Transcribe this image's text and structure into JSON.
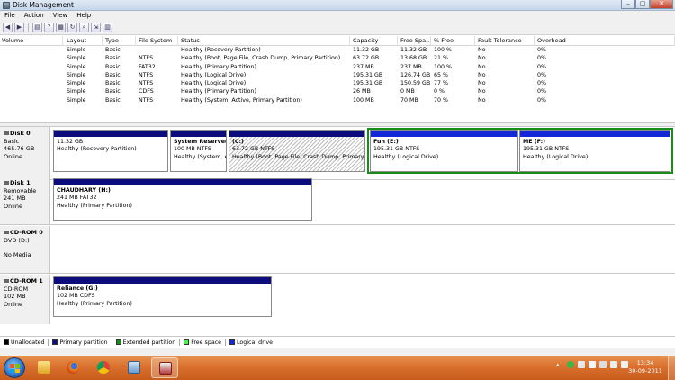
{
  "window": {
    "title": "Disk Management",
    "minimize": "–",
    "maximize": "□",
    "close": "✕"
  },
  "menu": [
    "File",
    "Action",
    "View",
    "Help"
  ],
  "toolbar": {
    "icons": [
      "back-icon",
      "forward-icon",
      "show-hide-tree-icon",
      "help-icon",
      "properties-icon",
      "refresh-icon",
      "rescan-icon",
      "export-icon",
      "view-icon"
    ]
  },
  "volume_list": {
    "columns": [
      "Volume",
      "Layout",
      "Type",
      "File System",
      "Status",
      "Capacity",
      "Free Spa...",
      "% Free",
      "Fault Tolerance",
      "Overhead"
    ],
    "rows": [
      {
        "volume": "",
        "layout": "Simple",
        "type": "Basic",
        "fs": "",
        "status": "Healthy (Recovery Partition)",
        "capacity": "11.32 GB",
        "free": "11.32 GB",
        "pct": "100 %",
        "fault": "No",
        "overhead": "0%"
      },
      {
        "volume": "(C:)",
        "layout": "Simple",
        "type": "Basic",
        "fs": "NTFS",
        "status": "Healthy (Boot, Page File, Crash Dump, Primary Partition)",
        "capacity": "63.72 GB",
        "free": "13.68 GB",
        "pct": "21 %",
        "fault": "No",
        "overhead": "0%"
      },
      {
        "volume": "CHAUDHARY (H:)",
        "layout": "Simple",
        "type": "Basic",
        "fs": "FAT32",
        "status": "Healthy (Primary Partition)",
        "capacity": "237 MB",
        "free": "237 MB",
        "pct": "100 %",
        "fault": "No",
        "overhead": "0%"
      },
      {
        "volume": "Fun (E:)",
        "layout": "Simple",
        "type": "Basic",
        "fs": "NTFS",
        "status": "Healthy (Logical Drive)",
        "capacity": "195.31 GB",
        "free": "126.74 GB",
        "pct": "65 %",
        "fault": "No",
        "overhead": "0%"
      },
      {
        "volume": "ME (F:)",
        "layout": "Simple",
        "type": "Basic",
        "fs": "NTFS",
        "status": "Healthy (Logical Drive)",
        "capacity": "195.31 GB",
        "free": "150.59 GB",
        "pct": "77 %",
        "fault": "No",
        "overhead": "0%"
      },
      {
        "volume": "Reliance (G:)",
        "layout": "Simple",
        "type": "Basic",
        "fs": "CDFS",
        "status": "Healthy (Primary Partition)",
        "capacity": "26 MB",
        "free": "0 MB",
        "pct": "0 %",
        "fault": "No",
        "overhead": "0%"
      },
      {
        "volume": "System Reserved",
        "layout": "Simple",
        "type": "Basic",
        "fs": "NTFS",
        "status": "Healthy (System, Active, Primary Partition)",
        "capacity": "100 MB",
        "free": "70 MB",
        "pct": "70 %",
        "fault": "No",
        "overhead": "0%"
      }
    ]
  },
  "disks": [
    {
      "name": "Disk 0",
      "line1": "Basic",
      "line2": "465.76 GB",
      "line3": "Online",
      "partitions": [
        {
          "name": "",
          "size": "11.32 GB",
          "status": "Healthy (Recovery Partition)"
        },
        {
          "name": "System Reserved",
          "size": "100 MB NTFS",
          "status": "Healthy (System, A"
        },
        {
          "name": "(C:)",
          "size": "63.72 GB NTFS",
          "status": "Healthy (Boot, Page File, Crash Dump, Primary Par"
        },
        {
          "name": "Fun  (E:)",
          "size": "195.31 GB NTFS",
          "status": "Healthy (Logical Drive)"
        },
        {
          "name": "ME  (F:)",
          "size": "195.31 GB NTFS",
          "status": "Healthy (Logical Drive)"
        }
      ]
    },
    {
      "name": "Disk 1",
      "line1": "Removable",
      "line2": "241 MB",
      "line3": "Online",
      "partitions": [
        {
          "name": "CHAUDHARY  (H:)",
          "size": "241 MB FAT32",
          "status": "Healthy (Primary Partition)"
        }
      ]
    },
    {
      "name": "CD-ROM 0",
      "line1": "DVD (D:)",
      "line2": "",
      "line3": "No Media",
      "partitions": []
    },
    {
      "name": "CD-ROM 1",
      "line1": "CD-ROM",
      "line2": "102 MB",
      "line3": "Online",
      "partitions": [
        {
          "name": "Reliance  (G:)",
          "size": "102 MB CDFS",
          "status": "Healthy (Primary Partition)"
        }
      ]
    }
  ],
  "legend": [
    {
      "label": "Unallocated",
      "color": "#000000"
    },
    {
      "label": "Primary partition",
      "color": "#0c0c7c"
    },
    {
      "label": "Extended partition",
      "color": "#1a8c1a"
    },
    {
      "label": "Free space",
      "color": "#3cff3c"
    },
    {
      "label": "Logical drive",
      "color": "#1428d8"
    }
  ],
  "taskbar": {
    "apps": [
      "windows-explorer-icon",
      "firefox-icon",
      "chrome-icon",
      "network-app-icon",
      "disk-management-icon"
    ],
    "clock_time": "13:34",
    "clock_date": "30-09-2011"
  }
}
